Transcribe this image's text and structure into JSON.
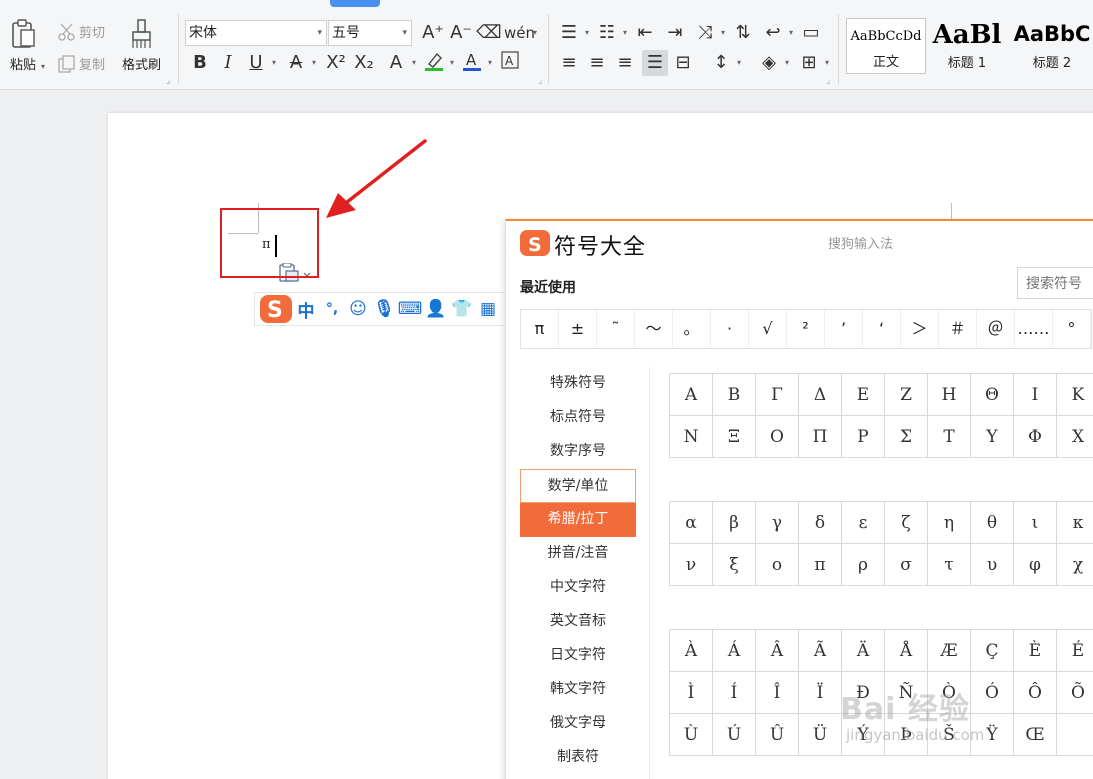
{
  "ribbon": {
    "clipboard": {
      "paste": "粘贴",
      "cut": "剪切",
      "copy": "复制",
      "format_painter": "格式刷"
    },
    "font_name": "宋体",
    "font_size": "五号",
    "pinyin_glyph": "wén"
  },
  "styles": [
    {
      "sample": "AaBbCcDd",
      "label": "正文"
    },
    {
      "sample": "AaBl",
      "label": "标题 1"
    },
    {
      "sample": "AaBbC",
      "label": "标题 2"
    }
  ],
  "document": {
    "inserted_char": "π"
  },
  "ime": {
    "mode_label": "中",
    "punct_label": "°,"
  },
  "panel": {
    "title": "符号大全",
    "brand": "搜狗输入法",
    "recent_label": "最近使用",
    "search_placeholder": "搜索符号",
    "recent": [
      "π",
      "±",
      "˜",
      "～",
      "。",
      "·",
      "√",
      "²",
      "’",
      "‘",
      "＞",
      "＃",
      "＠",
      "……",
      "°"
    ],
    "categories": [
      "特殊符号",
      "标点符号",
      "数字序号",
      "数学/单位",
      "希腊/拉丁",
      "拼音/注音",
      "中文字符",
      "英文音标",
      "日文字符",
      "韩文字符",
      "俄文字母",
      "制表符"
    ],
    "hover_category": "数学/单位",
    "active_category": "希腊/拉丁",
    "greek_upper": [
      "Α",
      "Β",
      "Γ",
      "Δ",
      "Ε",
      "Ζ",
      "Η",
      "Θ",
      "Ι",
      "Κ",
      "Ν",
      "Ξ",
      "Ο",
      "Π",
      "Ρ",
      "Σ",
      "Τ",
      "Υ",
      "Φ",
      "Χ"
    ],
    "greek_lower": [
      "α",
      "β",
      "γ",
      "δ",
      "ε",
      "ζ",
      "η",
      "θ",
      "ι",
      "κ",
      "ν",
      "ξ",
      "ο",
      "π",
      "ρ",
      "σ",
      "τ",
      "υ",
      "φ",
      "χ"
    ],
    "latin_ext": [
      "À",
      "Á",
      "Â",
      "Ã",
      "Ä",
      "Å",
      "Æ",
      "Ç",
      "È",
      "É",
      "Ì",
      "Í",
      "Î",
      "Ï",
      "Ð",
      "Ñ",
      "Ò",
      "Ó",
      "Ô",
      "Õ",
      "Ù",
      "Ú",
      "Û",
      "Ü",
      "Ý",
      "Þ",
      "Š",
      "Ÿ",
      "Œ",
      ""
    ]
  },
  "watermark": {
    "main": "Bai 经验",
    "sub": "jingyan.baidu.com"
  },
  "colors": {
    "accent_orange": "#f26b3a",
    "annotation_red": "#e02020",
    "ime_blue": "#1a6fd0",
    "ribbon_bg": "#f5f6f7"
  }
}
